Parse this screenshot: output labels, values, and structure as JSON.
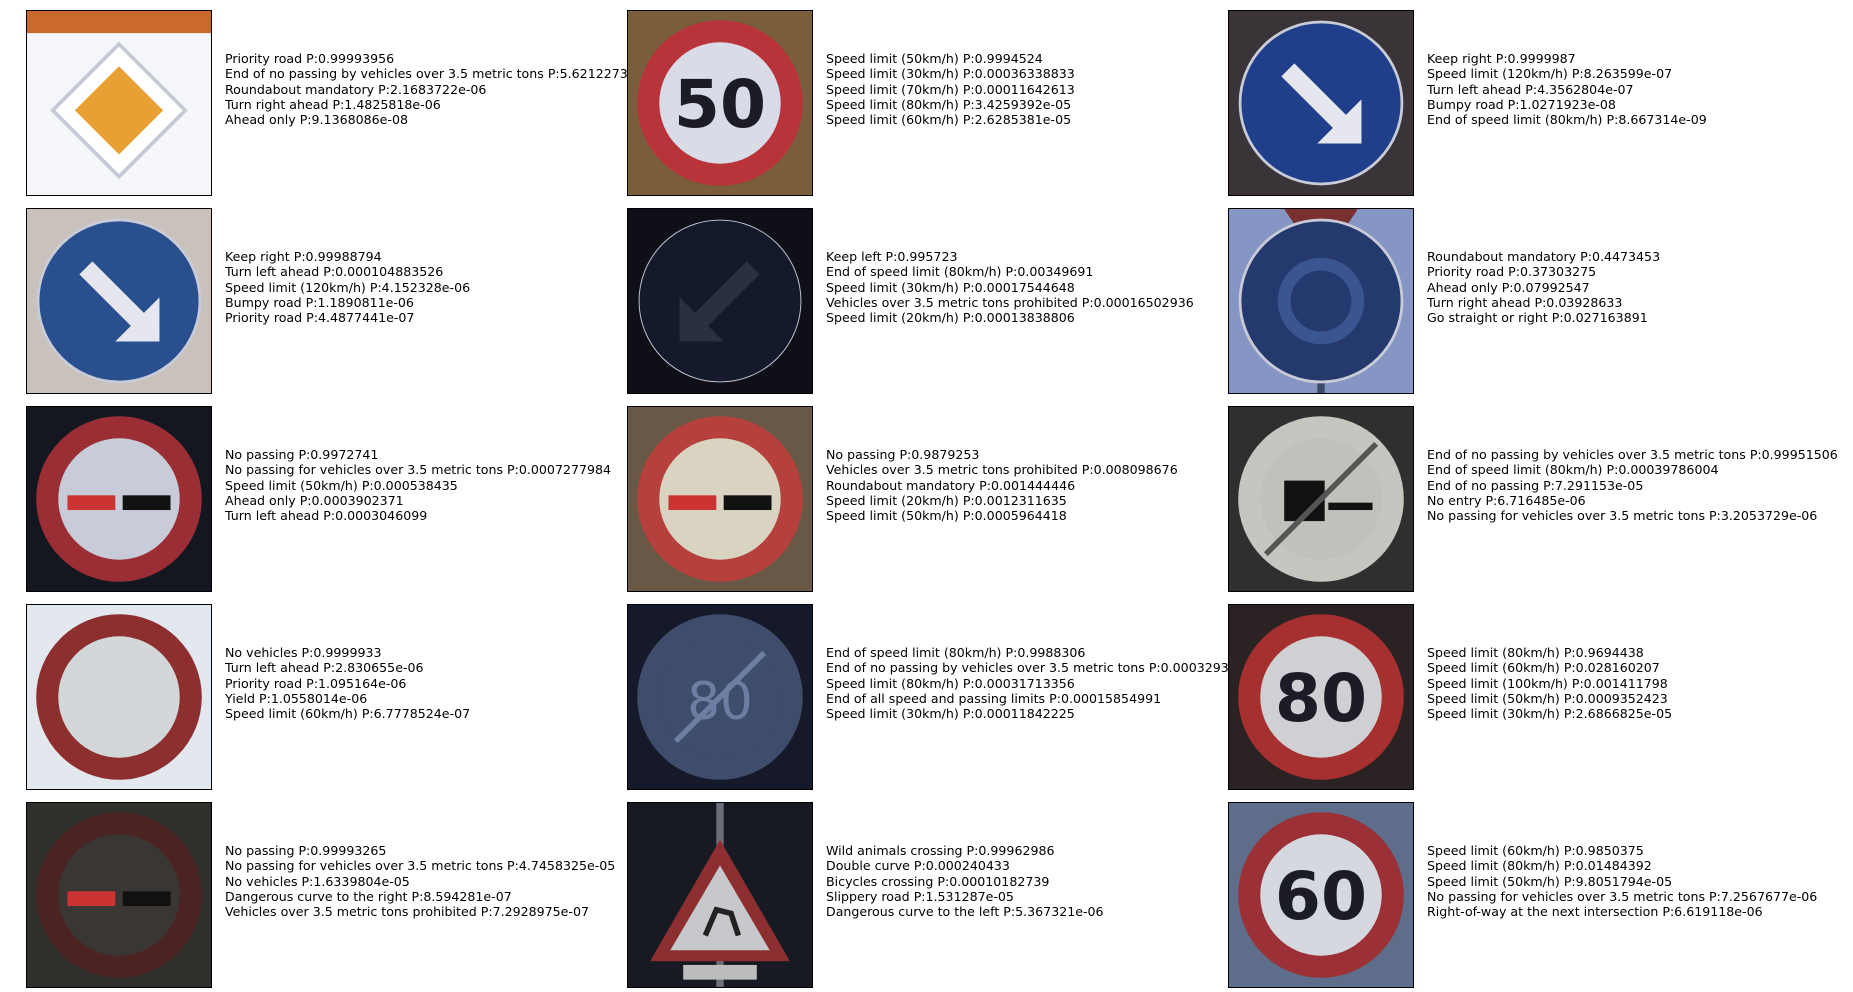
{
  "chart_data": {
    "type": "table",
    "panels": [
      {
        "predictions": [
          {
            "label": "Priority road",
            "p": "0.99993956"
          },
          {
            "label": "End of no passing by vehicles over 3.5 metric tons",
            "p": "5.6212273"
          },
          {
            "label": "Roundabout mandatory",
            "p": "2.1683722e-06"
          },
          {
            "label": "Turn right ahead",
            "p": "1.4825818e-06"
          },
          {
            "label": "Ahead only",
            "p": "9.1368086e-08"
          }
        ]
      },
      {
        "predictions": [
          {
            "label": "Speed limit (50km/h)",
            "p": "0.9994524"
          },
          {
            "label": "Speed limit (30km/h)",
            "p": "0.00036338833"
          },
          {
            "label": "Speed limit (70km/h)",
            "p": "0.00011642613"
          },
          {
            "label": "Speed limit (80km/h)",
            "p": "3.4259392e-05"
          },
          {
            "label": "Speed limit (60km/h)",
            "p": "2.6285381e-05"
          }
        ]
      },
      {
        "predictions": [
          {
            "label": "Keep right",
            "p": "0.9999987"
          },
          {
            "label": "Speed limit (120km/h)",
            "p": "8.263599e-07"
          },
          {
            "label": "Turn left ahead",
            "p": "4.3562804e-07"
          },
          {
            "label": "Bumpy road",
            "p": "1.0271923e-08"
          },
          {
            "label": "End of speed limit (80km/h)",
            "p": "8.667314e-09"
          }
        ]
      },
      {
        "predictions": [
          {
            "label": "Keep right",
            "p": "0.99988794"
          },
          {
            "label": "Turn left ahead",
            "p": "0.000104883526"
          },
          {
            "label": "Speed limit (120km/h)",
            "p": "4.152328e-06"
          },
          {
            "label": "Bumpy road",
            "p": "1.1890811e-06"
          },
          {
            "label": "Priority road",
            "p": "4.4877441e-07"
          }
        ]
      },
      {
        "predictions": [
          {
            "label": "Keep left",
            "p": "0.995723"
          },
          {
            "label": "End of speed limit (80km/h)",
            "p": "0.00349691"
          },
          {
            "label": "Speed limit (30km/h)",
            "p": "0.00017544648"
          },
          {
            "label": "Vehicles over 3.5 metric tons prohibited",
            "p": "0.00016502936"
          },
          {
            "label": "Speed limit (20km/h)",
            "p": "0.00013838806"
          }
        ]
      },
      {
        "predictions": [
          {
            "label": "Roundabout mandatory",
            "p": "0.4473453"
          },
          {
            "label": "Priority road",
            "p": "0.37303275"
          },
          {
            "label": "Ahead only",
            "p": "0.07992547"
          },
          {
            "label": "Turn right ahead",
            "p": "0.03928633"
          },
          {
            "label": "Go straight or right",
            "p": "0.027163891"
          }
        ]
      },
      {
        "predictions": [
          {
            "label": "No passing",
            "p": "0.9972741"
          },
          {
            "label": "No passing for vehicles over 3.5 metric tons",
            "p": "0.0007277984"
          },
          {
            "label": "Speed limit (50km/h)",
            "p": "0.000538435"
          },
          {
            "label": "Ahead only",
            "p": "0.0003902371"
          },
          {
            "label": "Turn left ahead",
            "p": "0.0003046099"
          }
        ]
      },
      {
        "predictions": [
          {
            "label": "No passing",
            "p": "0.9879253"
          },
          {
            "label": "Vehicles over 3.5 metric tons prohibited",
            "p": "0.008098676"
          },
          {
            "label": "Roundabout mandatory",
            "p": "0.001444446"
          },
          {
            "label": "Speed limit (20km/h)",
            "p": "0.0012311635"
          },
          {
            "label": "Speed limit (50km/h)",
            "p": "0.0005964418"
          }
        ]
      },
      {
        "predictions": [
          {
            "label": "End of no passing by vehicles over 3.5 metric tons",
            "p": "0.99951506"
          },
          {
            "label": "End of speed limit (80km/h)",
            "p": "0.00039786004"
          },
          {
            "label": "End of no passing",
            "p": "7.291153e-05"
          },
          {
            "label": "No entry",
            "p": "6.716485e-06"
          },
          {
            "label": "No passing for vehicles over 3.5 metric tons",
            "p": "3.2053729e-06"
          }
        ]
      },
      {
        "predictions": [
          {
            "label": "No vehicles",
            "p": "0.9999933"
          },
          {
            "label": "Turn left ahead",
            "p": "2.830655e-06"
          },
          {
            "label": "Priority road",
            "p": "1.095164e-06"
          },
          {
            "label": "Yield",
            "p": "1.0558014e-06"
          },
          {
            "label": "Speed limit (60km/h)",
            "p": "6.7778524e-07"
          }
        ]
      },
      {
        "predictions": [
          {
            "label": "End of speed limit (80km/h)",
            "p": "0.9988306"
          },
          {
            "label": "End of no passing by vehicles over 3.5 metric tons",
            "p": "0.0003293"
          },
          {
            "label": "Speed limit (80km/h)",
            "p": "0.00031713356"
          },
          {
            "label": "End of all speed and passing limits",
            "p": "0.00015854991"
          },
          {
            "label": "Speed limit (30km/h)",
            "p": "0.00011842225"
          }
        ]
      },
      {
        "predictions": [
          {
            "label": "Speed limit (80km/h)",
            "p": "0.9694438"
          },
          {
            "label": "Speed limit (60km/h)",
            "p": "0.028160207"
          },
          {
            "label": "Speed limit (100km/h)",
            "p": "0.001411798"
          },
          {
            "label": "Speed limit (50km/h)",
            "p": "0.0009352423"
          },
          {
            "label": "Speed limit (30km/h)",
            "p": "2.6866825e-05"
          }
        ]
      },
      {
        "predictions": [
          {
            "label": "No passing",
            "p": "0.99993265"
          },
          {
            "label": "No passing for vehicles over 3.5 metric tons",
            "p": "4.7458325e-05"
          },
          {
            "label": "No vehicles",
            "p": "1.6339804e-05"
          },
          {
            "label": "Dangerous curve to the right",
            "p": "8.594281e-07"
          },
          {
            "label": "Vehicles over 3.5 metric tons prohibited",
            "p": "7.2928975e-07"
          }
        ]
      },
      {
        "predictions": [
          {
            "label": "Wild animals crossing",
            "p": "0.99962986"
          },
          {
            "label": "Double curve",
            "p": "0.000240433"
          },
          {
            "label": "Bicycles crossing",
            "p": "0.00010182739"
          },
          {
            "label": "Slippery road",
            "p": "1.531287e-05"
          },
          {
            "label": "Dangerous curve to the left",
            "p": "5.367321e-06"
          }
        ]
      },
      {
        "predictions": [
          {
            "label": "Speed limit (60km/h)",
            "p": "0.9850375"
          },
          {
            "label": "Speed limit (80km/h)",
            "p": "0.01484392"
          },
          {
            "label": "Speed limit (50km/h)",
            "p": "9.8051794e-05"
          },
          {
            "label": "No passing for vehicles over 3.5 metric tons",
            "p": "7.2567677e-06"
          },
          {
            "label": "Right-of-way at the next intersection",
            "p": "6.619118e-06"
          }
        ]
      }
    ]
  },
  "thumbnails": [
    {
      "icon": "priority-road-sign-icon",
      "bg": "#f4f6fa",
      "ring": "#ffffff",
      "fill": "#e8a033"
    },
    {
      "icon": "speed-limit-50-sign-icon",
      "bg": "#7a5e3c",
      "ring": "#b8343a",
      "fill": "#d9dbe6",
      "text": "50"
    },
    {
      "icon": "keep-right-sign-icon",
      "bg": "#3a3438",
      "ring": "#1f3f8a",
      "fill": "#1f3f8a"
    },
    {
      "icon": "keep-right-sign-icon",
      "bg": "#c9c2bc",
      "ring": "#2a4f8f",
      "fill": "#2a4f8f"
    },
    {
      "icon": "keep-left-sign-icon",
      "bg": "#0e0f17",
      "ring": "#151a2a",
      "fill": "#141a2c"
    },
    {
      "icon": "roundabout-sign-icon",
      "bg": "#8696c4",
      "ring": "#24396e",
      "fill": "#24396e"
    },
    {
      "icon": "no-passing-sign-icon",
      "bg": "#141620",
      "ring": "#9b2e35",
      "fill": "#c7ccd8"
    },
    {
      "icon": "no-passing-sign-icon",
      "bg": "#6a5846",
      "ring": "#b6403c",
      "fill": "#d9d3c2"
    },
    {
      "icon": "end-no-passing-trucks-sign-icon",
      "bg": "#2d302f",
      "ring": "#c4c6c0",
      "fill": "#bfc2bb"
    },
    {
      "icon": "no-vehicles-sign-icon",
      "bg": "#e3e8ef",
      "ring": "#8d2f2f",
      "fill": "#d4d7da"
    },
    {
      "icon": "end-speed-limit-80-sign-icon",
      "bg": "#15192a",
      "ring": "#3e4d6c",
      "fill": "#3e4d6c"
    },
    {
      "icon": "speed-limit-80-sign-icon",
      "bg": "#2b2224",
      "ring": "#a6302f",
      "fill": "#cfd0d3",
      "text": "80"
    },
    {
      "icon": "no-passing-sign-icon",
      "bg": "#2f2f2c",
      "ring": "#4b2323",
      "fill": "#3a3634"
    },
    {
      "icon": "wild-animals-crossing-sign-icon",
      "bg": "#171a23",
      "ring": "#8d2f30",
      "fill": "#c7c8cc"
    },
    {
      "icon": "speed-limit-60-sign-icon",
      "bg": "#5e6e8a",
      "ring": "#9b3036",
      "fill": "#d6d8df",
      "text": "60"
    }
  ]
}
